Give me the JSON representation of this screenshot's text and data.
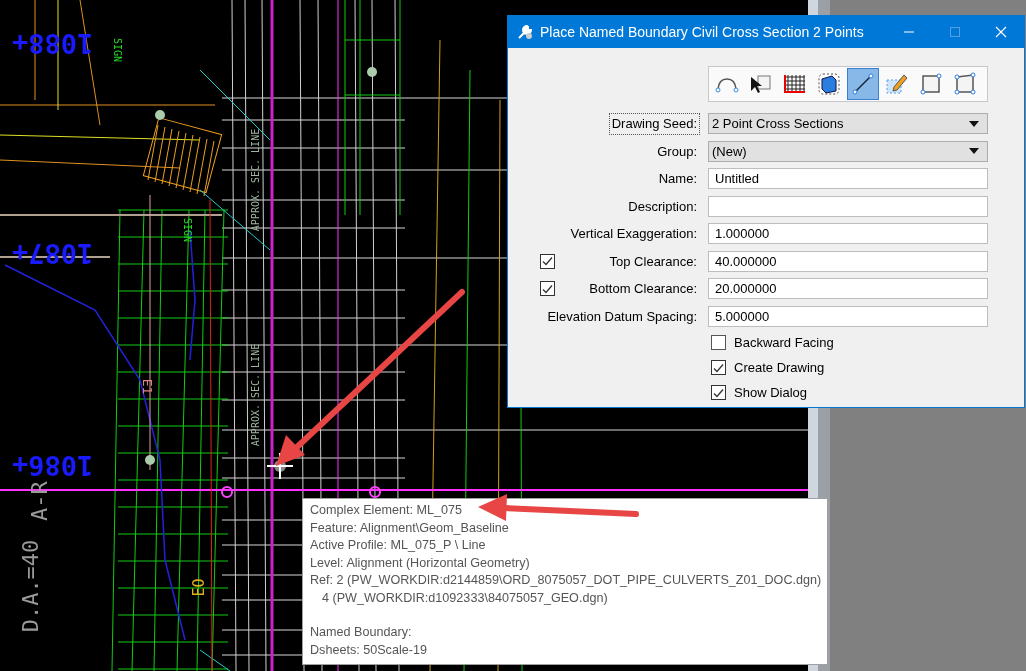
{
  "canvas": {
    "labels": [
      {
        "text": "1088+",
        "kind": "station"
      },
      {
        "text": "1087+",
        "kind": "station"
      },
      {
        "text": "1086+",
        "kind": "station"
      },
      {
        "text": "SIGN",
        "kind": "sign"
      },
      {
        "text": "SIGN",
        "kind": "sign"
      },
      {
        "text": "APPROX. SEC. LINE",
        "kind": "secline"
      },
      {
        "text": "APPROX. SEC. LINE",
        "kind": "secline"
      },
      {
        "text": "E1",
        "kind": "el"
      },
      {
        "text": "EO",
        "kind": "eo"
      },
      {
        "text": "D.A.=40",
        "kind": "dim"
      },
      {
        "text": "A-R",
        "kind": "dim"
      }
    ]
  },
  "dialog": {
    "title": "Place Named Boundary Civil Cross Section 2 Points",
    "window_controls": [
      {
        "disabled": false
      },
      {
        "disabled": true
      },
      {
        "disabled": false
      }
    ],
    "tools": [
      {
        "selected": false
      },
      {
        "selected": false
      },
      {
        "selected": false
      },
      {
        "selected": false
      },
      {
        "selected": true
      },
      {
        "selected": false
      },
      {
        "selected": false
      },
      {
        "selected": false
      }
    ],
    "fields": [
      {
        "label": "Drawing Seed:",
        "kind": "dropdown",
        "value": "2 Point Cross Sections",
        "focused": true
      },
      {
        "label": "Group:",
        "kind": "dropdown",
        "value": "(New)",
        "focused": false
      },
      {
        "label": "Name:",
        "kind": "text",
        "value": "Untitled",
        "focused": false
      },
      {
        "label": "Description:",
        "kind": "text",
        "focused": false
      },
      {
        "label": "Vertical Exaggeration:",
        "kind": "text",
        "value": "1.000000",
        "focused": false
      },
      {
        "label": "Top Clearance:",
        "kind": "text",
        "value": "40.000000",
        "checked": true,
        "focused": false
      },
      {
        "label": "Bottom Clearance:",
        "kind": "text",
        "value": "20.000000",
        "checked": true,
        "focused": false
      },
      {
        "label": "Elevation Datum Spacing:",
        "kind": "text",
        "value": "5.000000",
        "focused": false
      }
    ],
    "options": [
      {
        "label": "Backward Facing",
        "checked": false
      },
      {
        "label": "Create Drawing",
        "checked": true
      },
      {
        "label": "Show Dialog",
        "checked": true
      }
    ]
  },
  "tooltip": {
    "groups": [
      [
        {
          "text": "Complex Element: ML_075",
          "kind": "line"
        },
        {
          "text": "Feature: Alignment\\Geom_Baseline",
          "kind": "line"
        },
        {
          "text": "Active Profile: ML_075_P \\ Line",
          "kind": "line"
        },
        {
          "text": "Level: Alignment (Horizontal Geometry)",
          "kind": "line"
        },
        {
          "text": "Ref: 2 (PW_WORKDIR:d2144859\\ORD_8075057_DOT_PIPE_CULVERTS_Z01_DOC.dgn)",
          "kind": "line"
        },
        {
          "text": "4 (PW_WORKDIR:d1092333\\84075057_GEO.dgn)",
          "kind": "indent"
        }
      ],
      [
        {
          "text": "Named Boundary:",
          "kind": "line"
        },
        {
          "text": "Dsheets: 50Scale-19",
          "kind": "line"
        }
      ]
    ]
  }
}
